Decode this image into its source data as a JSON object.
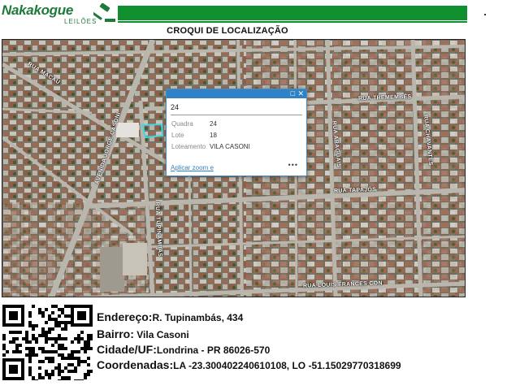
{
  "header": {
    "brand": "Nakakogue",
    "brand_sub": "LEILÕES",
    "accent": "#10902e"
  },
  "map_title": "CROQUI DE LOCALIZAÇÃO",
  "streets": {
    "macau": "RUA MACAU",
    "jorge_casoni": "AVENIDA JORGE CASONI",
    "tremembes": "RUA TREMEMBÉS",
    "araguais": "RUA ARAGUAIS",
    "chavantes": "RUA CHAVANTES",
    "tapajos": "RUA TAPAJÓS",
    "tupinambas": "RUA TUPINAMBÁS",
    "louis_frances_con": "RUA LOUIS FRANCES CON"
  },
  "popup": {
    "title": "24",
    "rows": [
      {
        "label": "Quadra",
        "value": "24"
      },
      {
        "label": "Lote",
        "value": "18"
      },
      {
        "label": "Loteamento",
        "value": "VILA CASONI"
      }
    ],
    "zoom_link": "Aplicar zoom e",
    "more": "•••",
    "maximize_icon": "□",
    "close_icon": "✕"
  },
  "info": {
    "endereco_label": "Endereço:",
    "endereco_value": "R. Tupinambás, 434",
    "bairro_label": "Bairro:",
    "bairro_value": " Vila Casoni",
    "cidade_label": "Cidade/UF:",
    "cidade_value": "Londrina - PR 86026-570",
    "coord_label": "Coordenadas:",
    "coord_value": "LA -23.300402240610108, LO -51.15029770318699"
  }
}
